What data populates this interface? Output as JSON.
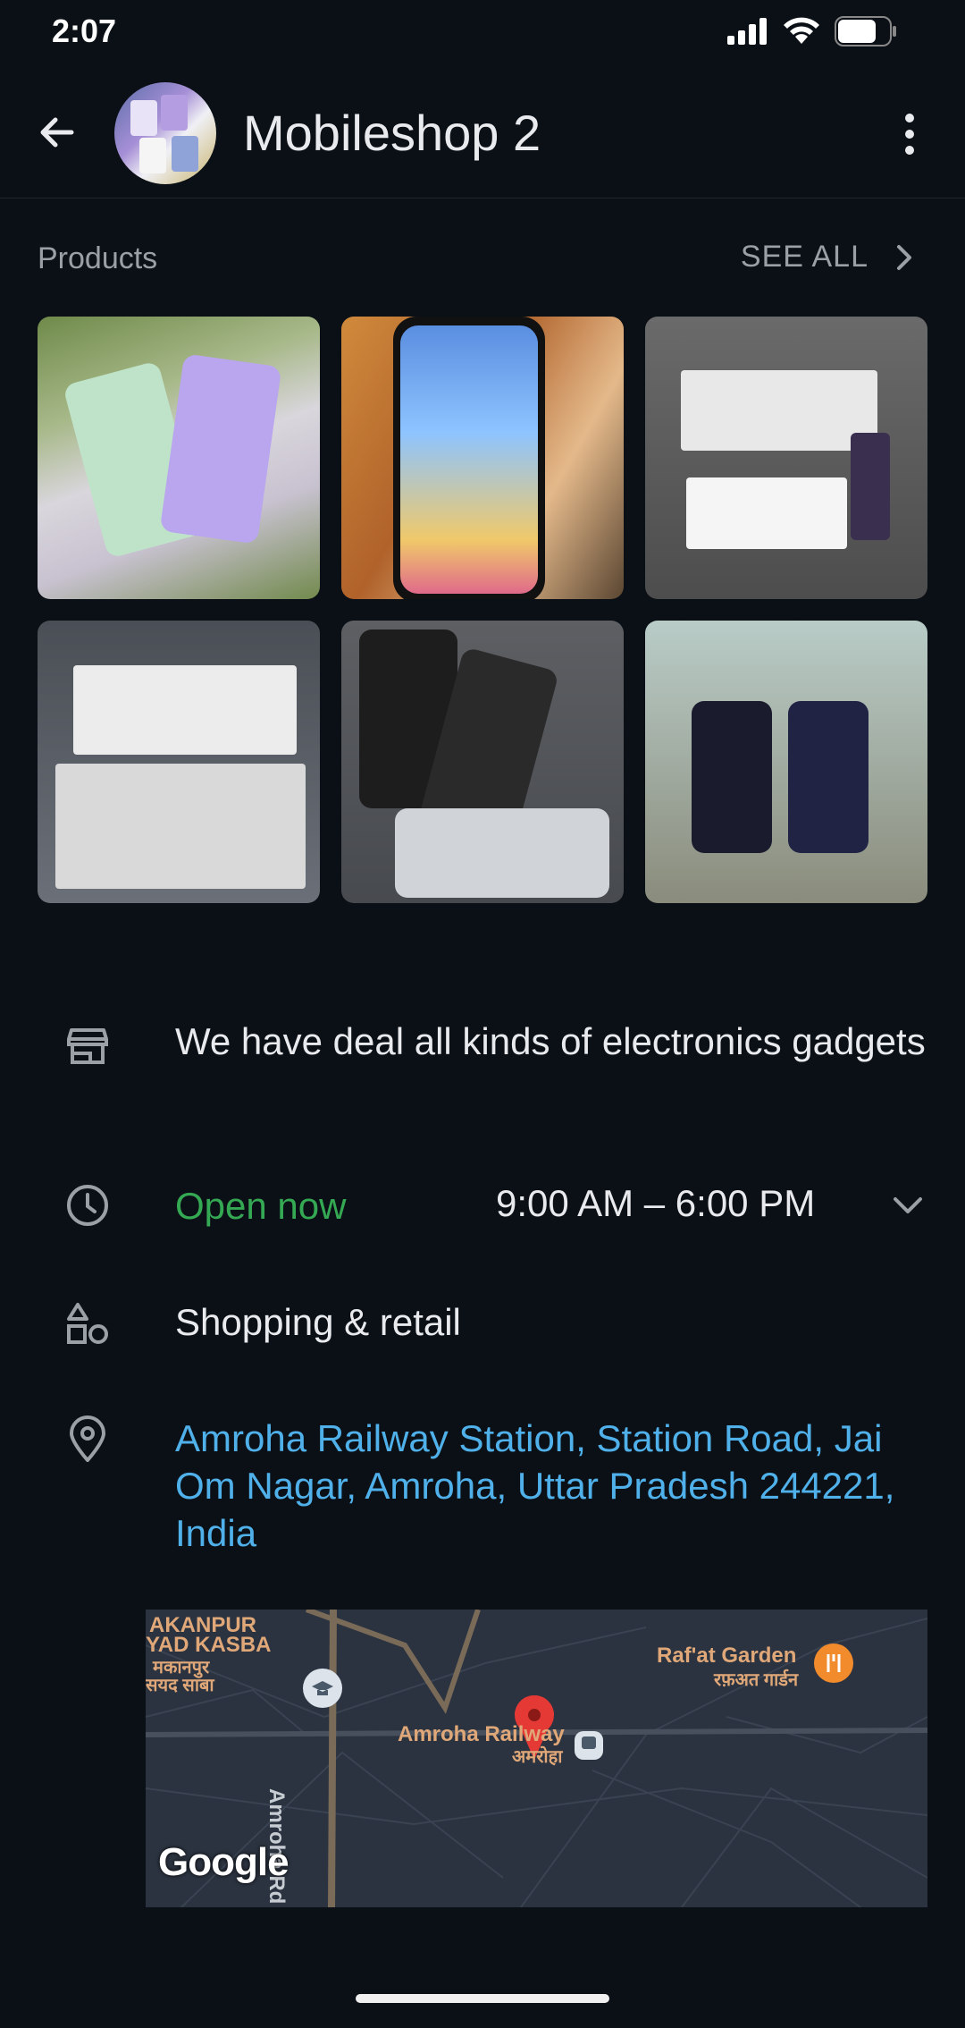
{
  "status_bar": {
    "time": "2:07"
  },
  "header": {
    "title": "Mobileshop 2"
  },
  "products": {
    "label": "Products",
    "see_all": "SEE ALL"
  },
  "info": {
    "description": "We have deal all kinds of electronics gadgets",
    "open_status": "Open now",
    "hours": "9:00 AM – 6:00 PM",
    "category": "Shopping & retail",
    "address": "Amroha Railway Station, Station Road, Jai Om Nagar, Amroha, Uttar Pradesh 244221, India"
  },
  "map": {
    "labels": {
      "akanpur": "AKANPUR",
      "yad_kasba": "YAD KASBA",
      "makanpur_hi": "मकानपुर",
      "sayad_saba_hi": "सयद साबा",
      "rafat_garden": "Raf'at Garden",
      "rafat_garden_hi": "रफ़अत गार्डन",
      "amroha_railway": "Amroha Railway",
      "amroha_hi": "अमरोहा",
      "amroha_rd": "Amroha Rd"
    },
    "provider": "Google"
  },
  "colors": {
    "background": "#0b1016",
    "open_green": "#34a853",
    "address_blue": "#4fb0ea",
    "map_pin": "#e53935"
  }
}
